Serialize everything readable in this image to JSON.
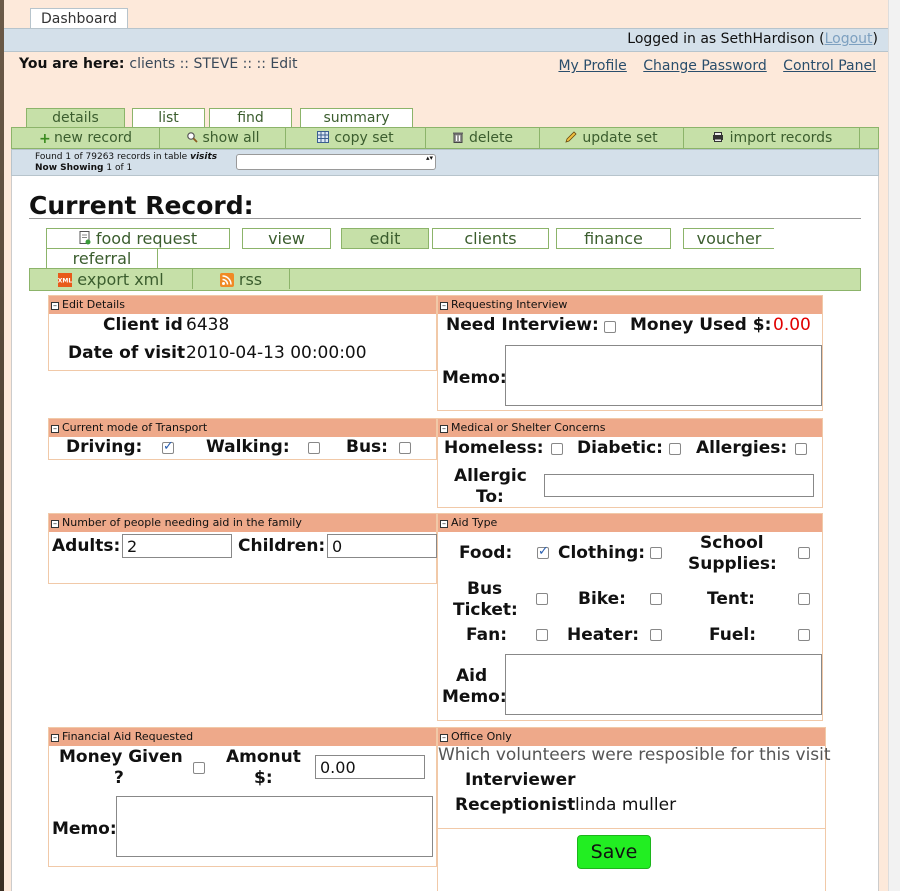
{
  "app": {
    "dashboard_tab": "Dashboard",
    "login_prefix": "Logged in as ",
    "username": "SethHardison",
    "logout_label": "Logout",
    "breadcrumb_prefix": "You are here: ",
    "breadcrumb": [
      "clients",
      "STEVE",
      "",
      "Edit"
    ],
    "breadcrumb_sep": " :: ",
    "top_links": [
      "My Profile",
      "Change Password",
      "Control Panel"
    ]
  },
  "tabs": [
    "details",
    "list",
    "find",
    "summary"
  ],
  "active_tab": "details",
  "actions": [
    {
      "label": "new record",
      "icon": "plus-icon"
    },
    {
      "label": "show all",
      "icon": "magnifier-icon"
    },
    {
      "label": "copy set",
      "icon": "table-icon"
    },
    {
      "label": "delete",
      "icon": "trash-icon"
    },
    {
      "label": "update set",
      "icon": "pencil-icon"
    },
    {
      "label": "import records",
      "icon": "printer-icon"
    }
  ],
  "found": {
    "found_label": "Found",
    "found_count": "1",
    "of_label": "of",
    "total": "79263",
    "records_in_table": "records in table",
    "table": "visits",
    "now_showing_label": "Now Showing",
    "showing": "1 of 1"
  },
  "record_title": "Current Record:",
  "subtabs": [
    "food request",
    "view",
    "edit",
    "clients",
    "finance",
    "voucher",
    "referral"
  ],
  "active_subtab": "edit",
  "export": [
    {
      "label": "export xml",
      "icon": "xml-icon"
    },
    {
      "label": "rss",
      "icon": "rss-icon"
    }
  ],
  "sections": {
    "edit_details": {
      "title": "Edit Details",
      "client_id_label": "Client id",
      "client_id": "6438",
      "date_label": "Date of visit",
      "date": "2010-04-13 00:00:00"
    },
    "interview": {
      "title": "Requesting Interview",
      "need_label": "Need Interview:",
      "need_checked": false,
      "money_used_label": "Money Used $:",
      "money_used": "0.00",
      "money_used_color": "#e00000",
      "memo_label": "Memo:",
      "memo": ""
    },
    "transport": {
      "title": "Current mode of Transport",
      "driving_label": "Driving:",
      "driving_checked": true,
      "walking_label": "Walking:",
      "walking_checked": false,
      "bus_label": "Bus:",
      "bus_checked": false
    },
    "medical": {
      "title": "Medical or Shelter Concerns",
      "homeless_label": "Homeless:",
      "homeless_checked": false,
      "diabetic_label": "Diabetic:",
      "diabetic_checked": false,
      "allergies_label": "Allergies:",
      "allergies_checked": false,
      "allergic_label_1": "Allergic",
      "allergic_label_2": "To:",
      "allergic_to": ""
    },
    "people": {
      "title": "Number of people needing aid in the family",
      "adults_label": "Adults:",
      "adults": "2",
      "children_label": "Children:",
      "children": "0"
    },
    "aid": {
      "title": "Aid Type",
      "food_label": "Food:",
      "food_checked": true,
      "clothing_label": "Clothing:",
      "clothing_checked": false,
      "school_label_1": "School",
      "school_label_2": "Supplies:",
      "school_checked": false,
      "bus_label_1": "Bus",
      "bus_label_2": "Ticket:",
      "bus_checked": false,
      "bike_label": "Bike:",
      "bike_checked": false,
      "tent_label": "Tent:",
      "tent_checked": false,
      "fan_label": "Fan:",
      "fan_checked": false,
      "heater_label": "Heater:",
      "heater_checked": false,
      "fuel_label": "Fuel:",
      "fuel_checked": false,
      "memo_label_1": "Aid",
      "memo_label_2": "Memo:",
      "memo": ""
    },
    "financial": {
      "title": "Financial Aid Requested",
      "money_given_label_1": "Money Given",
      "money_given_label_2": "?",
      "money_given_checked": false,
      "amount_label_1": "Amonut",
      "amount_label_2": "$:",
      "amount": "0.00",
      "memo_label": "Memo:",
      "memo": ""
    },
    "office": {
      "title": "Office Only",
      "note": "Which volunteers were resposible for this visit",
      "interviewer_label": "Interviewer",
      "interviewer": "",
      "receptionist_label": "Receptionist",
      "receptionist": "linda muller"
    }
  },
  "save_label": "Save",
  "colors": {
    "page_bg": "#fde9da",
    "tab_green": "#c6e0a8",
    "section_header": "#eea98a",
    "save_button": "#22ee22",
    "blue_bar": "#d4e0ea"
  }
}
